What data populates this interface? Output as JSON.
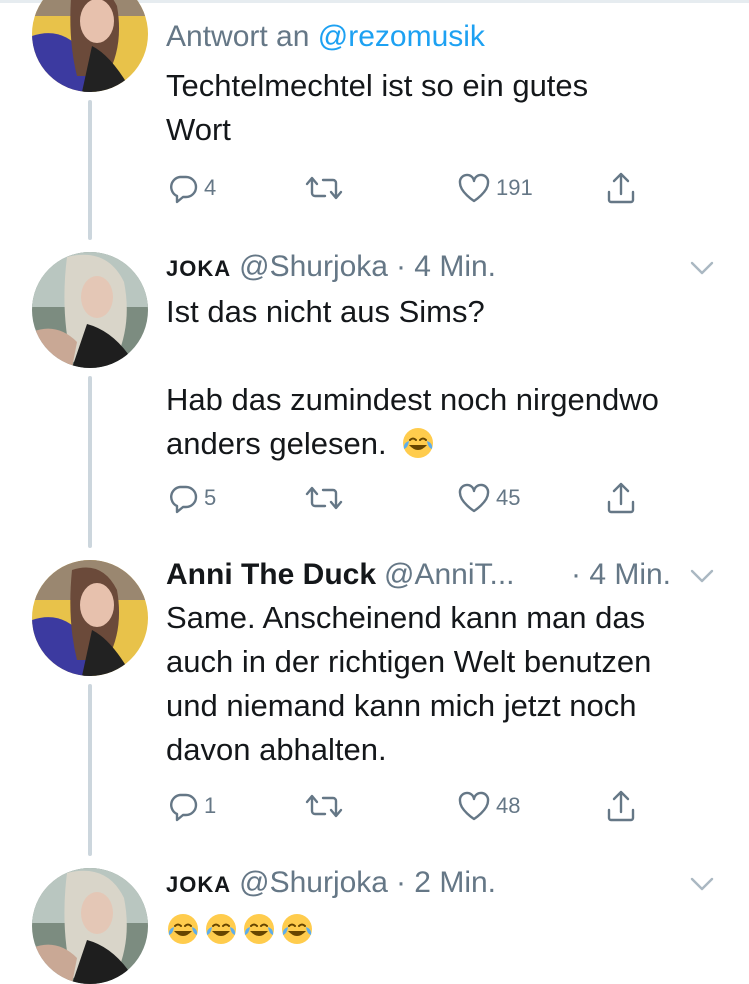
{
  "tweets": [
    {
      "reply_prefix": "Antwort an",
      "reply_handle": "@rezomusik",
      "text_lines": [
        "Techtelmechtel ist so ein gutes",
        "Wort"
      ],
      "replies": "4",
      "retweets": "",
      "likes": "191"
    },
    {
      "name": "JOKA",
      "handle": "@Shurjoka",
      "time": "· 4 Min.",
      "text_lines": [
        "Ist das nicht aus Sims?",
        "",
        "Hab das zumindest noch nirgendwo",
        "anders gelesen."
      ],
      "emoji": "face-with-tears-of-joy",
      "replies": "5",
      "likes": "45"
    },
    {
      "name": "Anni The Duck",
      "handle": "@AnniT...",
      "time": "· 4 Min.",
      "text_lines": [
        "Same. Anscheinend kann man das",
        "auch in der richtigen Welt benutzen",
        "und niemand kann mich jetzt noch",
        "davon abhalten."
      ],
      "replies": "1",
      "likes": "48"
    },
    {
      "name": "JOKA",
      "handle": "@Shurjoka",
      "time": "· 2 Min.",
      "emoji_count": 4,
      "emoji": "face-with-tears-of-joy"
    }
  ],
  "icons": {
    "reply": "reply-icon",
    "retweet": "retweet-icon",
    "like": "heart-icon",
    "share": "share-icon",
    "more": "chevron-down-icon"
  },
  "colors": {
    "link": "#1da1f2",
    "secondary": "#657786",
    "thread_line": "#ccd6dd",
    "text": "#14171a"
  }
}
